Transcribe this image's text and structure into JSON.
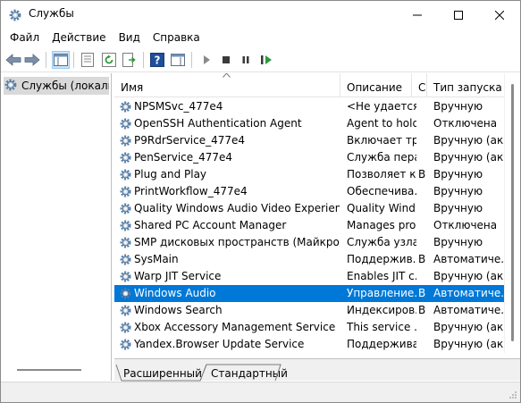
{
  "window": {
    "title": "Службы",
    "icon": "gear-icon"
  },
  "menu": [
    "Файл",
    "Действие",
    "Вид",
    "Справка"
  ],
  "toolbar": {
    "buttons": [
      "back-arrow-icon",
      "forward-arrow-icon",
      "show-hide-tree-icon",
      "properties-icon",
      "refresh-icon",
      "export-list-icon",
      "help-icon",
      "show-hide-action-pane-icon",
      "start-service-icon",
      "stop-service-icon",
      "pause-service-icon",
      "resume-service-icon"
    ]
  },
  "tree": {
    "item": "Службы (локальные)"
  },
  "columns": {
    "name": "Имя",
    "description": "Описание",
    "state": "С",
    "startup": "Тип запуска"
  },
  "services": [
    {
      "name": "NPSMSvc_477e4",
      "description": "<Не удается...",
      "state": "",
      "startup": "Вручную"
    },
    {
      "name": "OpenSSH Authentication Agent",
      "description": "Agent to hold...",
      "state": "",
      "startup": "Отключена"
    },
    {
      "name": "P9RdrService_477e4",
      "description": "Включает тр...",
      "state": "",
      "startup": "Вручную (ак..."
    },
    {
      "name": "PenService_477e4",
      "description": "Служба пера",
      "state": "",
      "startup": "Вручную (ак..."
    },
    {
      "name": "Plug and Play",
      "description": "Позволяет к...",
      "state": "В",
      "startup": "Вручную"
    },
    {
      "name": "PrintWorkflow_477e4",
      "description": "Обеспечива...",
      "state": "",
      "startup": "Вручную"
    },
    {
      "name": "Quality Windows Audio Video Experience",
      "description": "Quality Wind...",
      "state": "",
      "startup": "Вручную"
    },
    {
      "name": "Shared PC Account Manager",
      "description": "Manages pro...",
      "state": "",
      "startup": "Отключена"
    },
    {
      "name": "SMP дисковых пространств (Майкрософт)",
      "description": "Служба узла...",
      "state": "",
      "startup": "Вручную"
    },
    {
      "name": "SysMain",
      "description": "Поддержив...",
      "state": "В",
      "startup": "Автоматиче..."
    },
    {
      "name": "Warp JIT Service",
      "description": "Enables JIT c...",
      "state": "",
      "startup": "Вручную (ак..."
    },
    {
      "name": "Windows Audio",
      "description": "Управление...",
      "state": "В",
      "startup": "Автоматиче...",
      "selected": true
    },
    {
      "name": "Windows Search",
      "description": "Индексиров...",
      "state": "В",
      "startup": "Автоматиче..."
    },
    {
      "name": "Xbox Accessory Management Service",
      "description": "This service ...",
      "state": "",
      "startup": "Вручную (ак..."
    },
    {
      "name": "Yandex.Browser Update Service",
      "description": "Поддержива...",
      "state": "",
      "startup": "Вручную (ак..."
    }
  ],
  "tabs": [
    "Расширенный",
    "Стандартный"
  ],
  "colors": {
    "selection": "#0078d7",
    "tree_selection": "#d9d9d9",
    "toolbar_active": "#cce4f7"
  }
}
